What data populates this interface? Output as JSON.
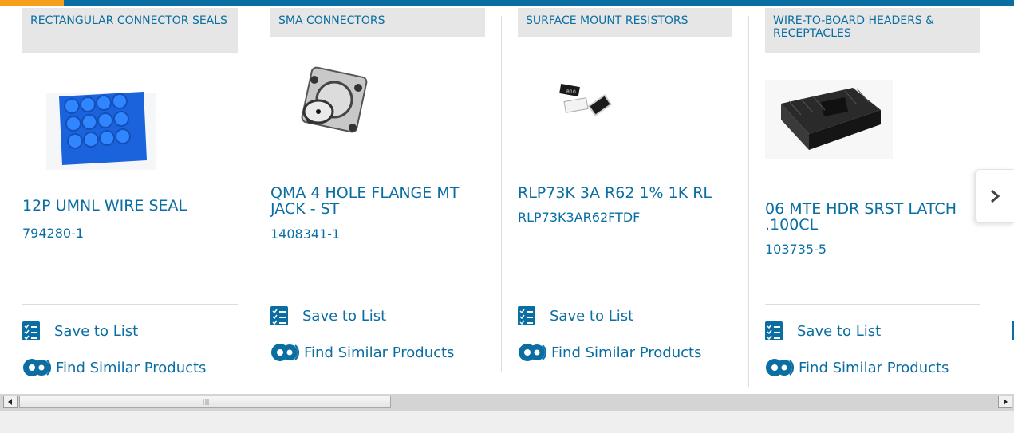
{
  "colors": {
    "brand": "#0a6ea3",
    "accent": "#f5a01a"
  },
  "products": [
    {
      "category": "RECTANGULAR CONNECTOR SEALS",
      "title": "12P UMNL WIRE SEAL",
      "part_number": "794280-1",
      "image_icon": "blue-connector-seal-image"
    },
    {
      "category": "SMA CONNECTORS",
      "title": "QMA 4 HOLE FLANGE MT JACK - ST",
      "part_number": "1408341-1",
      "image_icon": "flange-connector-image"
    },
    {
      "category": "SURFACE MOUNT RESISTORS",
      "title": "RLP73K 3A R62 1% 1K RL",
      "part_number": "RLP73K3AR62FTDF",
      "image_icon": "smd-resistor-image"
    },
    {
      "category": "WIRE-TO-BOARD HEADERS & RECEPTACLES",
      "title": "06 MTE HDR SRST LATCH .100CL",
      "part_number": "103735-5",
      "image_icon": "pin-header-image"
    }
  ],
  "actions": {
    "save_label": "Save to List",
    "find_label": "Find Similar Products"
  },
  "navigation": {
    "next_icon": "chevron-right-icon"
  },
  "scrollbar": {
    "left_icon": "arrow-left-icon",
    "right_icon": "arrow-right-icon"
  }
}
